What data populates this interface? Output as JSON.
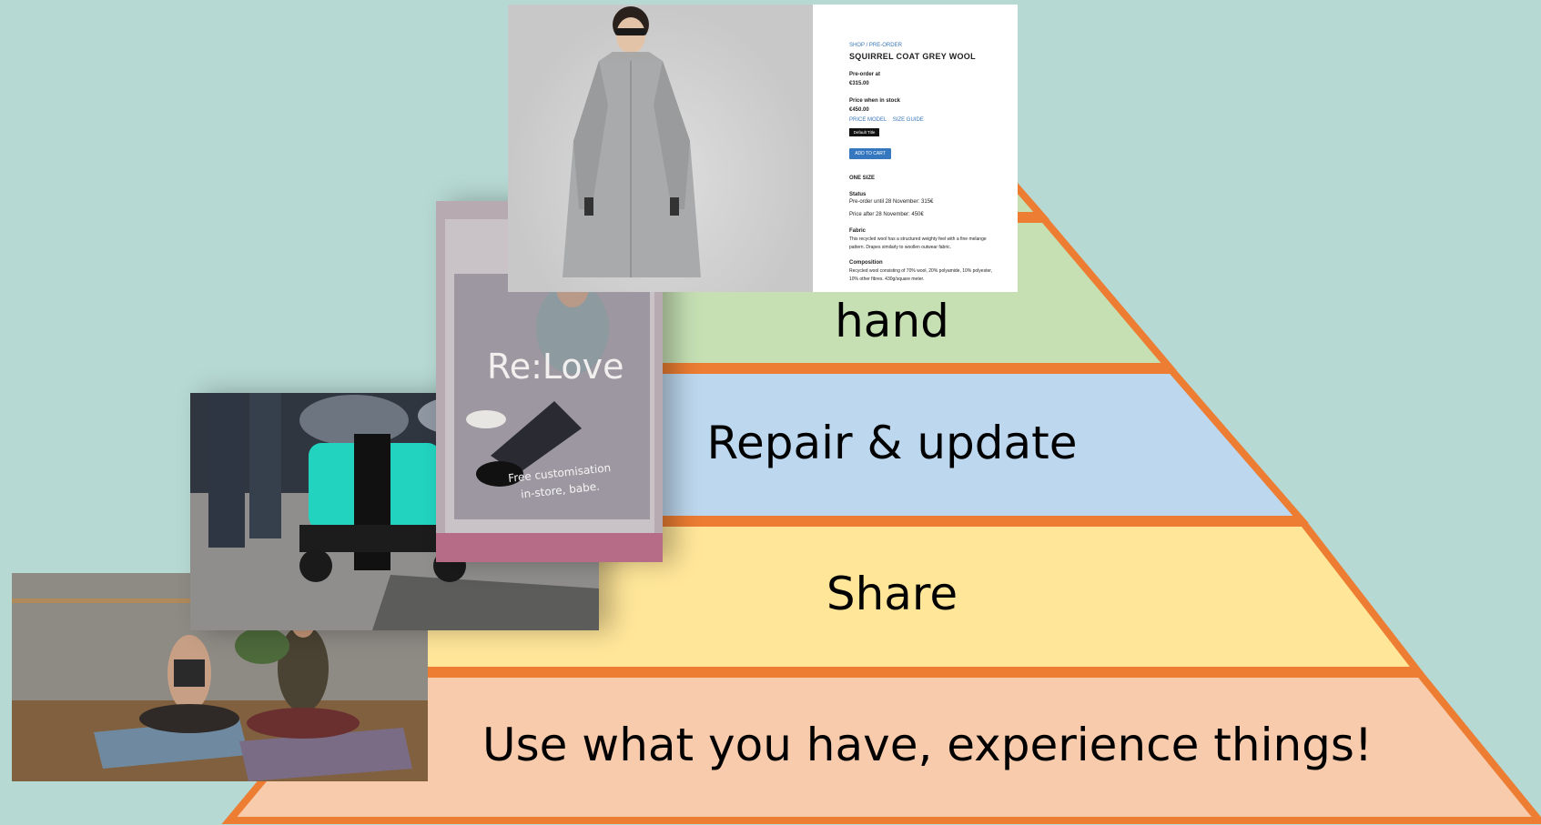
{
  "pyramid": {
    "colors": {
      "outline": "#ec7d32",
      "level_top": "#c6e0b4",
      "level_repair": "#bdd7ee",
      "level_share": "#ffe699",
      "level_base": "#f8cbad"
    },
    "labels": {
      "hand": "hand",
      "repair": "Repair & update",
      "share": "Share",
      "base": "Use what you have, experience things!"
    }
  },
  "coat_product": {
    "breadcrumb": "SHOP / PRE-ORDER",
    "title": "SQUIRREL COAT GREY WOOL",
    "preorder_label": "Pre-order at",
    "preorder_price": "€315.00",
    "instock_label": "Price when in stock",
    "instock_price": "€450.00",
    "links": "PRICE MODEL    SIZE GUIDE",
    "default_title_btn": "Default Title",
    "add_to_cart_btn": "ADD TO CART",
    "size": "ONE SIZE",
    "status_label": "Status",
    "status_line1": "Pre-order until 28 November: 315€",
    "status_line2": "Price after 28 November: 450€",
    "fabric_label": "Fabric",
    "fabric_line1": "This recycled wool has a structured weighty feel with a fine melange",
    "fabric_line2": "pattern. Drapes similarly to woollen outwear fabric.",
    "composition_label": "Composition",
    "composition_line1": "Recycled wool consisting of 70% wool, 20% polyamide, 10% polyester,",
    "composition_line2": "10% other fibres. 430g/square meter."
  },
  "relove_photo": {
    "headline": "Re:Love",
    "sub_line1": "Free customisation",
    "sub_line2": "in-store, babe."
  }
}
